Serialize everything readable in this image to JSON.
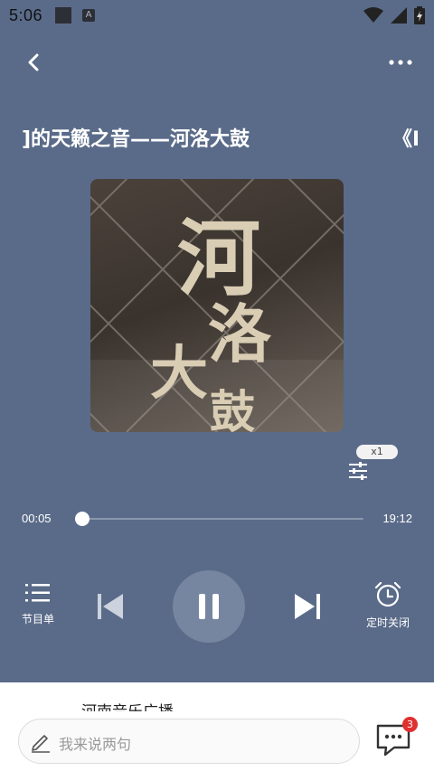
{
  "status_bar": {
    "time": "5:06",
    "notif_letter": "A"
  },
  "top_bar": {
    "back_icon": "chevron-left-icon",
    "more_icon": "more-horizontal-icon"
  },
  "track": {
    "title": "]的天籁之音——河洛大鼓",
    "title_tail": "《I",
    "cover_chars": [
      "河",
      "洛",
      "大",
      "鼓"
    ]
  },
  "playback": {
    "speed": "x1",
    "current_time": "00:05",
    "total_time": "19:12",
    "progress_fraction": 0.004
  },
  "controls": {
    "playlist_label": "节目单",
    "timer_label": "定时关闭",
    "state": "playing"
  },
  "bottom": {
    "peek_text": "河南音乐广播",
    "comment_placeholder": "我来说两句",
    "comment_count": "3"
  },
  "colors": {
    "background": "#5a6b89",
    "play_button": "#7686a0",
    "badge": "#e03030"
  }
}
